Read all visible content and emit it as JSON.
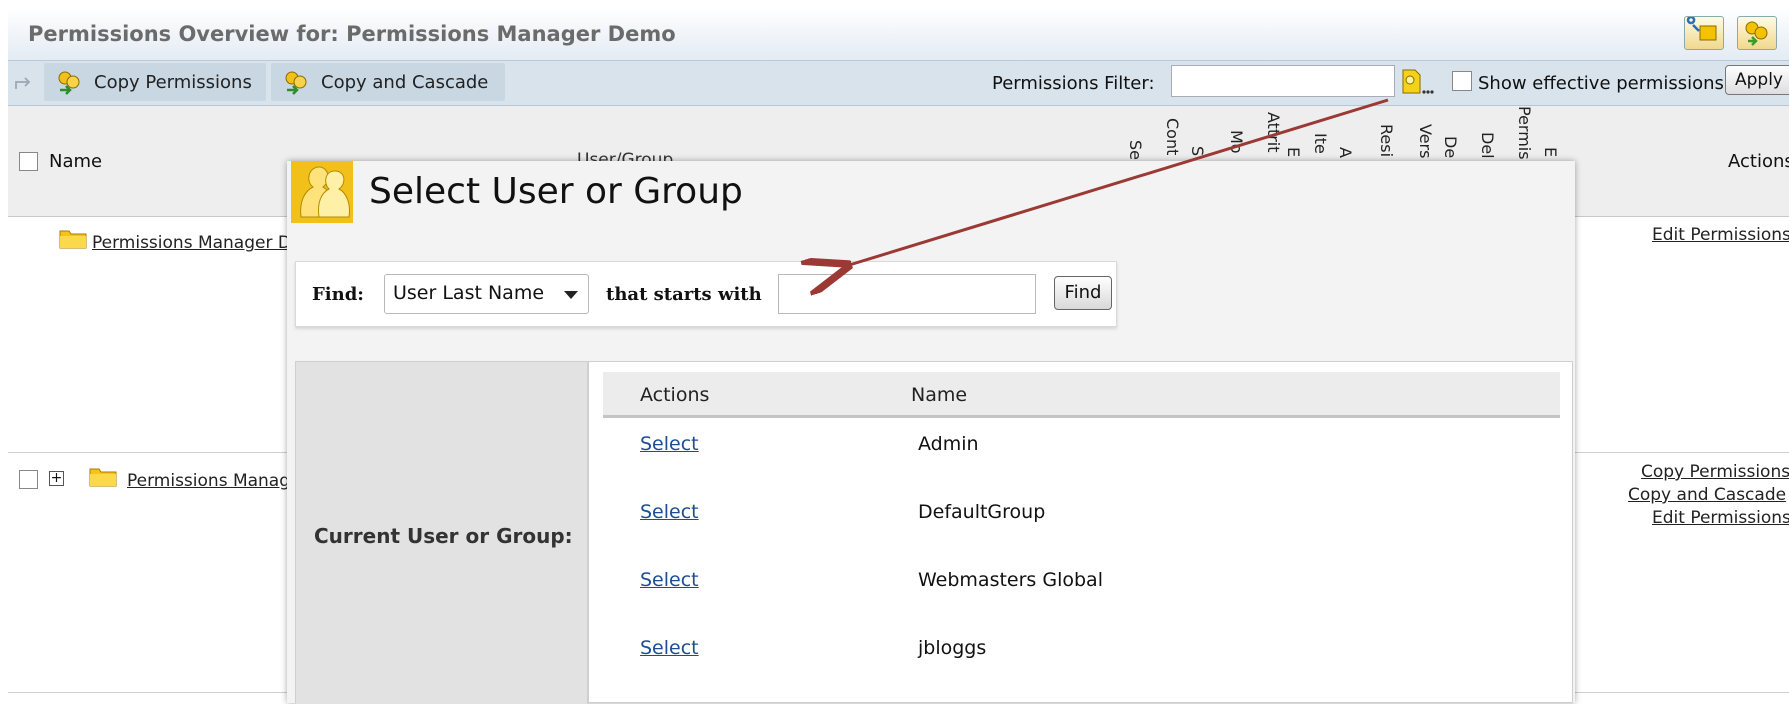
{
  "header": {
    "title": "Permissions Overview for: Permissions Manager Demo"
  },
  "toolbar": {
    "copy_permissions": "Copy Permissions",
    "copy_and_cascade": "Copy and Cascade",
    "filter_label": "Permissions Filter:",
    "filter_value": "",
    "show_effective_label": "Show effective permissions",
    "show_effective_checked": false,
    "apply_label": "Apply"
  },
  "table": {
    "name_header": "Name",
    "usergroup_header": "User/Group",
    "actions_header": "Actions",
    "permission_columns": [
      "Se",
      "Cont",
      "S",
      "Mo",
      "Attrit",
      "E",
      "Ite",
      "A",
      "Resi",
      "Vers",
      "De",
      "Del",
      "Permis",
      "E"
    ],
    "rows": [
      {
        "name": "Permissions Manager D",
        "actions": [
          "Edit Permissions"
        ]
      },
      {
        "name": "Permissions Manag",
        "actions": [
          "Copy Permissions",
          "Copy and Cascade",
          "Edit Permissions"
        ]
      }
    ]
  },
  "modal": {
    "title": "Select User or Group",
    "find_label": "Find:",
    "find_by_selected": "User Last Name",
    "starts_with_label": "that starts with",
    "find_value": "",
    "find_button": "Find",
    "current_label": "Current User or Group:",
    "list_headers": [
      "Actions",
      "Name"
    ],
    "items": [
      {
        "action": "Select",
        "name": "Admin"
      },
      {
        "action": "Select",
        "name": "DefaultGroup"
      },
      {
        "action": "Select",
        "name": "Webmasters Global"
      },
      {
        "action": "Select",
        "name": "jbloggs"
      }
    ]
  },
  "colors": {
    "link_blue": "#1d4e93",
    "arrow_red": "#9b3a34",
    "toolbar_bg": "#d8e3ec"
  }
}
